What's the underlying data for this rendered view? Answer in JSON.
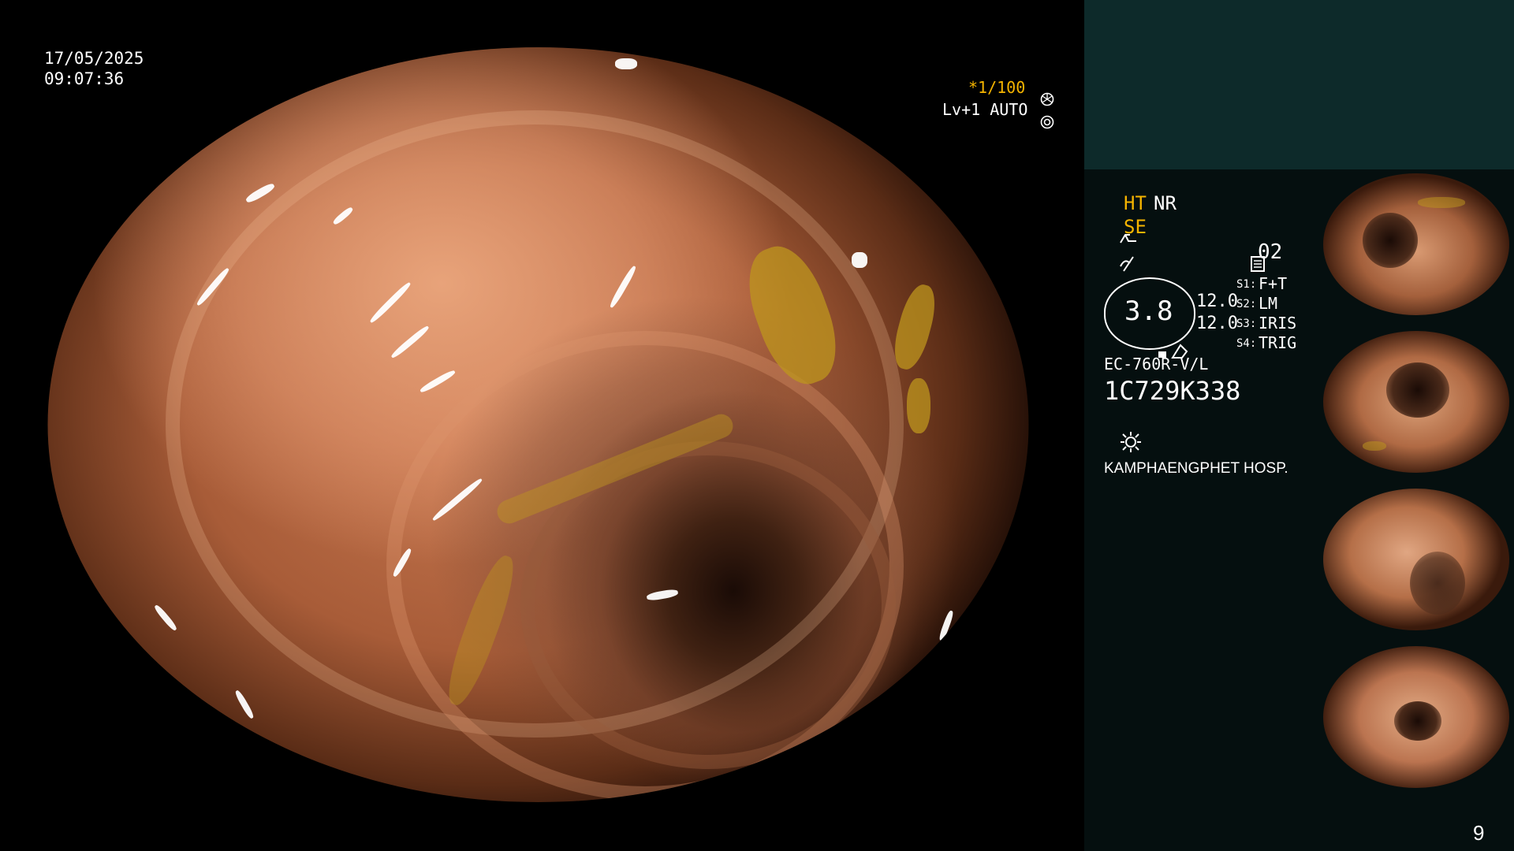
{
  "osd": {
    "date": "17/05/2025",
    "time": "09:07:36",
    "shutter": "*1/100",
    "level": "Lv+1 AUTO",
    "mode_ht": "HT",
    "mode_nr": "NR",
    "mode_se": "SE",
    "memo_number": "02",
    "zoom_value": "3.8",
    "value_1": "12.0",
    "value_2": "12.0",
    "s1": "S1:",
    "s1_value": "F+T",
    "s2": "S2:",
    "s2_value": "LM",
    "s3": "S3:",
    "s3_value": "IRIS",
    "s4": "S4:",
    "s4_value": "TRIG",
    "scope_model": "EC-760R-V/L",
    "scope_serial": "1C729K338",
    "hospital": "KAMPHAENGPHET HOSP.",
    "page_number": "9"
  },
  "icons": {
    "shutter": "aperture-icon",
    "level": "gear-icon",
    "se_mode": "scope-mode-icon",
    "enhancement": "wave-icon",
    "memo": "memo-icon",
    "light": "light-icon"
  },
  "colors": {
    "background": "#000000",
    "panel_top": "#0d2a2a",
    "panel_bottom": "#050f0f",
    "highlight_yellow": "#f5b400",
    "text_white": "#ffffff"
  },
  "thumbnails": [
    {
      "label": "capture-1"
    },
    {
      "label": "capture-2"
    },
    {
      "label": "capture-3"
    },
    {
      "label": "capture-4"
    }
  ]
}
